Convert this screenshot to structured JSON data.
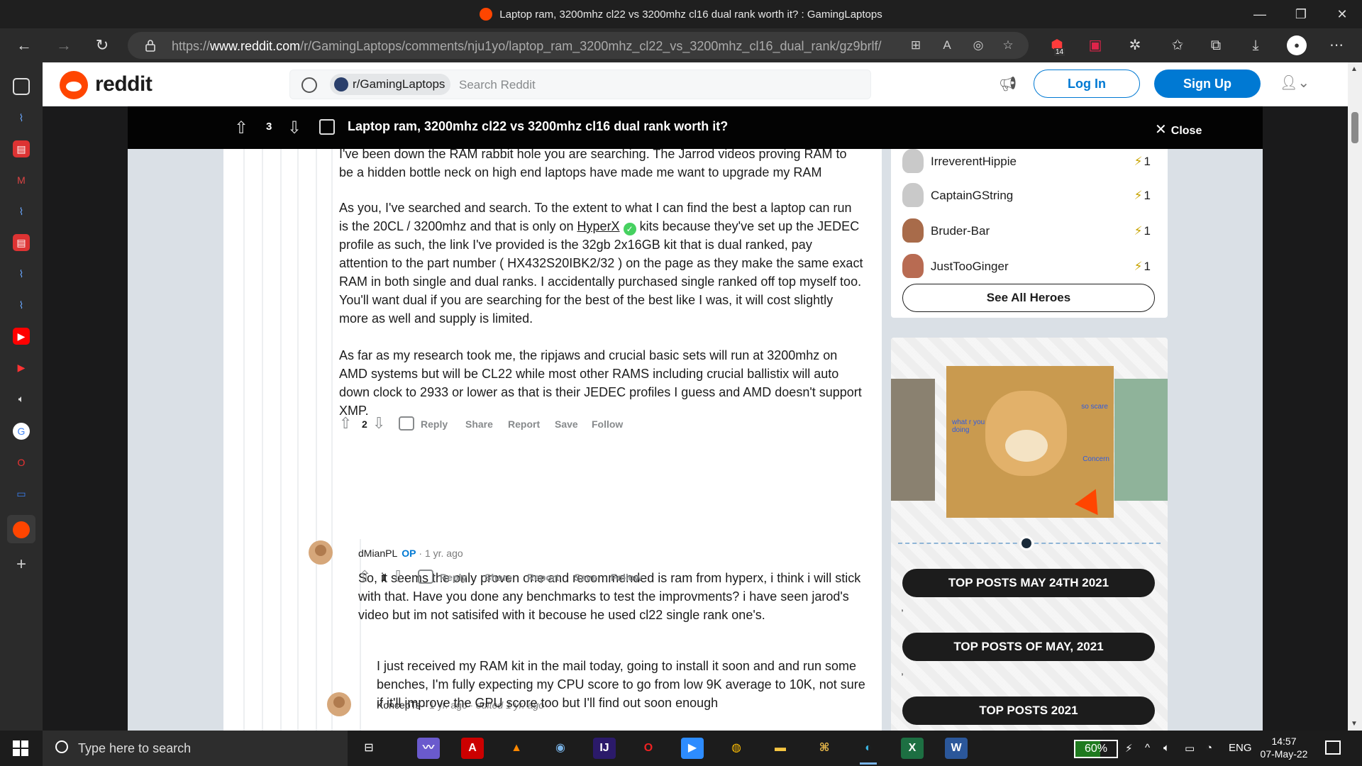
{
  "browser": {
    "window_title": "Laptop ram, 3200mhz cl22 vs 3200mhz cl16 dual rank worth it? : GamingLaptops",
    "url_prefix": "https://",
    "url_domain": "www.reddit.com",
    "url_path": "/r/GamingLaptops/comments/nju1yo/laptop_ram_3200mhz_cl22_vs_3200mhz_cl16_dual_rank/gz9brlf/",
    "extension_badge": "14",
    "minimize": "—",
    "maximize": "❐",
    "close": "✕"
  },
  "reddit_header": {
    "wordmark": "reddit",
    "community_chip": "r/GamingLaptops",
    "search_placeholder": "Search Reddit",
    "login_label": "Log In",
    "signup_label": "Sign Up"
  },
  "post_bar": {
    "score": "3",
    "title": "Laptop ram, 3200mhz cl22 vs 3200mhz cl16 dual rank worth it?",
    "close_label": "Close"
  },
  "comment1": {
    "p1": "I've been down the RAM rabbit hole you are searching. The Jarrod videos proving RAM to be a hidden bottle neck on high end laptops have made me want to upgrade my RAM",
    "p2_before_link": "As you, I've searched and search. To the extent to what I can find the best a laptop can run is the 20CL / 3200mhz and that is only on ",
    "p2_link": "HyperX",
    "p2_after_link": " kits because they've set up the JEDEC profile as such, the link I've provided is the 32gb 2x16GB kit that is dual ranked, pay attention to the part number ( HX432S20IBK2/32 ) on the page as they make the same exact RAM in both single and dual ranks. I accidentally purchased single ranked off top myself too. You'll want dual if you are searching for the best of the best like I was, it will cost slightly more as well and supply is limited.",
    "p3": "As far as my research took me, the ripjaws and crucial basic sets will run at 3200mhz on AMD systems but will be CL22 while most other RAMS including crucial ballistix will auto down clock to 2933 or lower as that is their JEDEC profiles I guess and AMD doesn't support XMP.",
    "votes": "2"
  },
  "comment2": {
    "author": "dMianPL",
    "op_badge": "OP",
    "time": "· 1 yr. ago",
    "body": "So, it seems the only proven one and recommended is ram from hyperx, i think i will stick with that. Have you done any benchmarks to test the improvments? i have seen jarod's video but im not satisifed with it becouse he used cl22 single rank one's.",
    "votes": "1"
  },
  "comment3": {
    "author": "KoncepTs",
    "time": "· 1 yr. ago ·",
    "edited": "edited 1 yr. ago",
    "body": "I just received my RAM kit in the mail today, going to install it soon and and run some benches, I'm fully expecting my CPU score to go from low 9K average to 10K, not sure if it'll improve the GPU score too but I'll find out soon enough"
  },
  "actions": {
    "reply": "Reply",
    "share": "Share",
    "report": "Report",
    "save": "Save",
    "follow": "Follow"
  },
  "heroes": {
    "items": [
      {
        "name": "IrreverentHippie",
        "karma": "1"
      },
      {
        "name": "CaptainGString",
        "karma": "1"
      },
      {
        "name": "Bruder-Bar",
        "karma": "1"
      },
      {
        "name": "JustTooGinger",
        "karma": "1"
      }
    ],
    "see_all": "See All Heroes"
  },
  "promo": {
    "meme_text_1": "so scare",
    "meme_text_2": "what r you doing",
    "meme_text_3": "Concern",
    "buttons": [
      "TOP POSTS MAY 24TH 2021",
      "TOP POSTS OF MAY, 2021",
      "TOP POSTS 2021"
    ],
    "separator": ","
  },
  "taskbar": {
    "search_placeholder": "Type here to search",
    "battery": "60%",
    "language": "ENG",
    "time": "14:57",
    "date": "07-May-22"
  },
  "colors": {
    "reddit_orange": "#ff4500",
    "reddit_blue": "#0079d3",
    "op_blue": "#0079d3"
  }
}
